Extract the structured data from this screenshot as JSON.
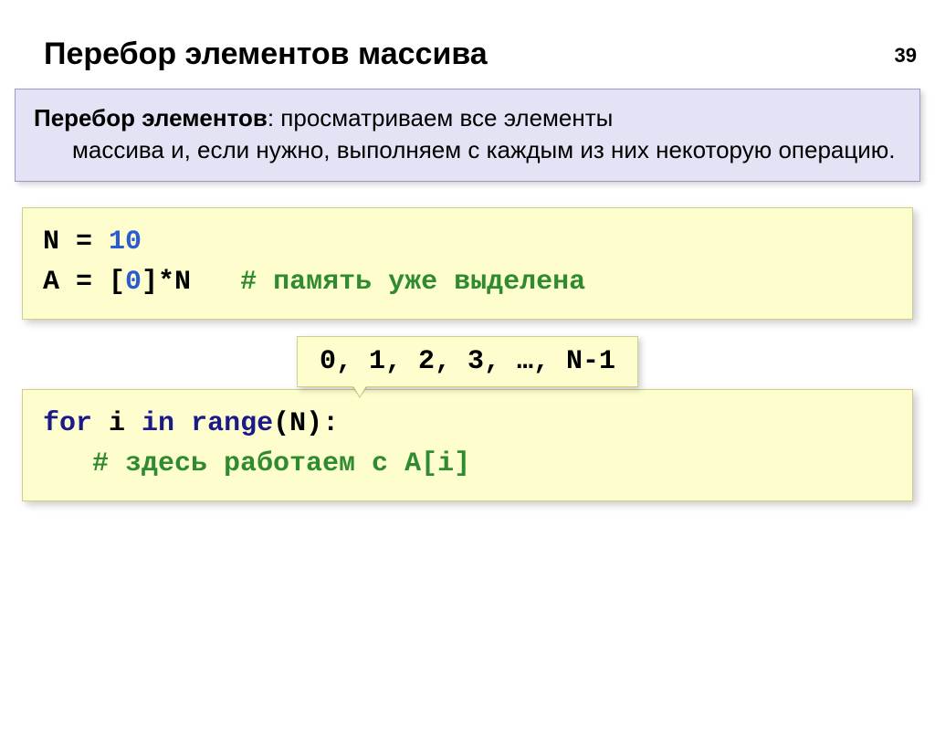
{
  "page_number": "39",
  "title": "Перебор элементов массива",
  "definition": {
    "term": "Перебор элементов",
    "body_line1": ": просматриваем все элементы",
    "body_rest": "массива и, если нужно, выполняем с каждым из них некоторую операцию."
  },
  "code_block_1": {
    "line1_a": "N = ",
    "line1_b": "10",
    "line2_a": "A = [",
    "line2_b": "0",
    "line2_c": "]*N   ",
    "line2_d": "# память уже выделена"
  },
  "callout": "0, 1, 2, 3, …, N-1",
  "code_block_2": {
    "line1_a": "for",
    "line1_b": " i ",
    "line1_c": "in",
    "line1_d": " ",
    "line1_e": "range",
    "line1_f": "(N):",
    "line2": "   # здесь работаем с A[i]"
  }
}
